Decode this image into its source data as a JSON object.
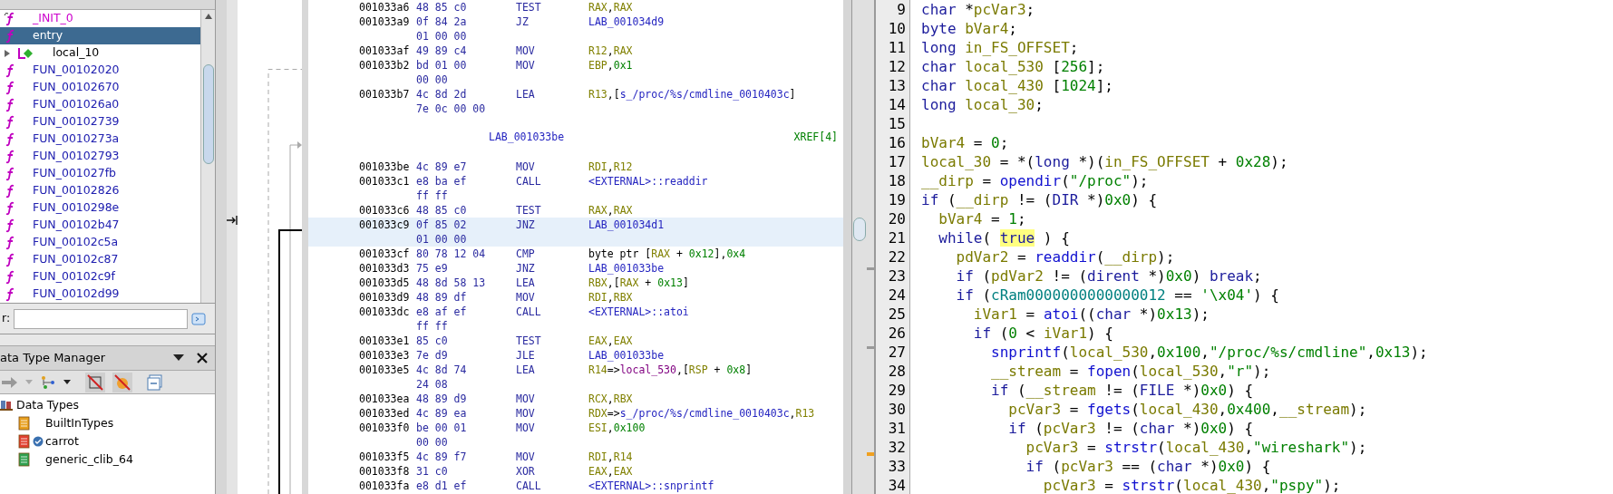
{
  "symbol_tree": {
    "items": [
      {
        "kind": "thunk",
        "label": "_INIT_0",
        "selected": false
      },
      {
        "kind": "function",
        "label": "entry",
        "selected": true
      },
      {
        "kind": "label",
        "label": "local_10",
        "selected": false,
        "expanded": false
      },
      {
        "kind": "function",
        "label": "FUN_00102020",
        "selected": false
      },
      {
        "kind": "function",
        "label": "FUN_00102670",
        "selected": false
      },
      {
        "kind": "function",
        "label": "FUN_001026a0",
        "selected": false
      },
      {
        "kind": "function",
        "label": "FUN_00102739",
        "selected": false
      },
      {
        "kind": "function",
        "label": "FUN_0010273a",
        "selected": false
      },
      {
        "kind": "function",
        "label": "FUN_00102793",
        "selected": false
      },
      {
        "kind": "function",
        "label": "FUN_001027fb",
        "selected": false
      },
      {
        "kind": "function",
        "label": "FUN_00102826",
        "selected": false
      },
      {
        "kind": "function",
        "label": "FUN_0010298e",
        "selected": false
      },
      {
        "kind": "function",
        "label": "FUN_00102b47",
        "selected": false
      },
      {
        "kind": "function",
        "label": "FUN_00102c5a",
        "selected": false
      },
      {
        "kind": "function",
        "label": "FUN_00102c87",
        "selected": false
      },
      {
        "kind": "function",
        "label": "FUN_00102c9f",
        "selected": false
      },
      {
        "kind": "function",
        "label": "FUN_00102d99",
        "selected": false
      }
    ],
    "filter_label": "r:"
  },
  "data_type_manager": {
    "title": "ata Type Manager",
    "root": "Data Types",
    "archives": [
      {
        "label": "BuiltInTypes",
        "color": "#e8a020",
        "verified": false
      },
      {
        "label": "carrot",
        "color": "#e04030",
        "verified": true
      },
      {
        "label": "generic_clib_64",
        "color": "#30a050",
        "verified": false
      }
    ]
  },
  "listing": {
    "items": [
      {
        "kind": "instruction",
        "selected": false,
        "address": "001033a6",
        "bytes": [
          "48 85 c0"
        ],
        "mnemonic": "TEST",
        "operands": [
          {
            "text": "RAX",
            "kind": "register"
          },
          {
            "text": ",",
            "kind": "plain"
          },
          {
            "text": "RAX",
            "kind": "register"
          }
        ]
      },
      {
        "kind": "instruction",
        "selected": false,
        "address": "001033a9",
        "bytes": [
          "0f 84 2a",
          "01 00 00"
        ],
        "mnemonic": "JZ",
        "operands": [
          {
            "text": "LAB_001034d9",
            "kind": "reference"
          }
        ]
      },
      {
        "kind": "instruction",
        "selected": false,
        "address": "001033af",
        "bytes": [
          "49 89 c4"
        ],
        "mnemonic": "MOV",
        "operands": [
          {
            "text": "R12",
            "kind": "register"
          },
          {
            "text": ",",
            "kind": "plain"
          },
          {
            "text": "RAX",
            "kind": "register"
          }
        ]
      },
      {
        "kind": "instruction",
        "selected": false,
        "address": "001033b2",
        "bytes": [
          "bd 01 00",
          "00 00"
        ],
        "mnemonic": "MOV",
        "operands": [
          {
            "text": "EBP",
            "kind": "register"
          },
          {
            "text": ",",
            "kind": "plain"
          },
          {
            "text": "0x1",
            "kind": "number"
          }
        ]
      },
      {
        "kind": "instruction",
        "selected": false,
        "address": "001033b7",
        "bytes": [
          "4c 8d 2d",
          "7e 0c 00 00"
        ],
        "mnemonic": "LEA",
        "operands": [
          {
            "text": "R13",
            "kind": "register"
          },
          {
            "text": ",[",
            "kind": "plain"
          },
          {
            "text": "s_/proc/%s/cmdline_0010403c",
            "kind": "reference"
          },
          {
            "text": "]",
            "kind": "plain"
          }
        ]
      },
      {
        "kind": "label",
        "selected": false,
        "label": "LAB_001033be",
        "xref": "XREF[4]"
      },
      {
        "kind": "instruction",
        "selected": false,
        "address": "001033be",
        "bytes": [
          "4c 89 e7"
        ],
        "mnemonic": "MOV",
        "operands": [
          {
            "text": "RDI",
            "kind": "register"
          },
          {
            "text": ",",
            "kind": "plain"
          },
          {
            "text": "R12",
            "kind": "register"
          }
        ]
      },
      {
        "kind": "instruction",
        "selected": false,
        "address": "001033c1",
        "bytes": [
          "e8 ba ef",
          "ff ff"
        ],
        "mnemonic": "CALL",
        "operands": [
          {
            "text": "<EXTERNAL>::readdir",
            "kind": "reference"
          }
        ]
      },
      {
        "kind": "instruction",
        "selected": false,
        "address": "001033c6",
        "bytes": [
          "48 85 c0"
        ],
        "mnemonic": "TEST",
        "operands": [
          {
            "text": "RAX",
            "kind": "register"
          },
          {
            "text": ",",
            "kind": "plain"
          },
          {
            "text": "RAX",
            "kind": "register"
          }
        ]
      },
      {
        "kind": "instruction",
        "selected": true,
        "address": "001033c9",
        "bytes": [
          "0f 85 02",
          "01 00 00"
        ],
        "mnemonic": "JNZ",
        "operands": [
          {
            "text": "LAB_001034d1",
            "kind": "reference"
          }
        ]
      },
      {
        "kind": "instruction",
        "selected": false,
        "address": "001033cf",
        "bytes": [
          "80 78 12 04"
        ],
        "mnemonic": "CMP",
        "operands": [
          {
            "text": "byte ptr [",
            "kind": "plain"
          },
          {
            "text": "RAX",
            "kind": "register"
          },
          {
            "text": " + ",
            "kind": "plain"
          },
          {
            "text": "0x12",
            "kind": "number"
          },
          {
            "text": "],",
            "kind": "plain"
          },
          {
            "text": "0x4",
            "kind": "number"
          }
        ]
      },
      {
        "kind": "instruction",
        "selected": false,
        "address": "001033d3",
        "bytes": [
          "75 e9"
        ],
        "mnemonic": "JNZ",
        "operands": [
          {
            "text": "LAB_001033be",
            "kind": "reference"
          }
        ]
      },
      {
        "kind": "instruction",
        "selected": false,
        "address": "001033d5",
        "bytes": [
          "48 8d 58 13"
        ],
        "mnemonic": "LEA",
        "operands": [
          {
            "text": "RBX",
            "kind": "register"
          },
          {
            "text": ",[",
            "kind": "plain"
          },
          {
            "text": "RAX",
            "kind": "register"
          },
          {
            "text": " + ",
            "kind": "plain"
          },
          {
            "text": "0x13",
            "kind": "number"
          },
          {
            "text": "]",
            "kind": "plain"
          }
        ]
      },
      {
        "kind": "instruction",
        "selected": false,
        "address": "001033d9",
        "bytes": [
          "48 89 df"
        ],
        "mnemonic": "MOV",
        "operands": [
          {
            "text": "RDI",
            "kind": "register"
          },
          {
            "text": ",",
            "kind": "plain"
          },
          {
            "text": "RBX",
            "kind": "register"
          }
        ]
      },
      {
        "kind": "instruction",
        "selected": false,
        "address": "001033dc",
        "bytes": [
          "e8 af ef",
          "ff ff"
        ],
        "mnemonic": "CALL",
        "operands": [
          {
            "text": "<EXTERNAL>::atoi",
            "kind": "reference"
          }
        ]
      },
      {
        "kind": "instruction",
        "selected": false,
        "address": "001033e1",
        "bytes": [
          "85 c0"
        ],
        "mnemonic": "TEST",
        "operands": [
          {
            "text": "EAX",
            "kind": "register"
          },
          {
            "text": ",",
            "kind": "plain"
          },
          {
            "text": "EAX",
            "kind": "register"
          }
        ]
      },
      {
        "kind": "instruction",
        "selected": false,
        "address": "001033e3",
        "bytes": [
          "7e d9"
        ],
        "mnemonic": "JLE",
        "operands": [
          {
            "text": "LAB_001033be",
            "kind": "reference"
          }
        ]
      },
      {
        "kind": "instruction",
        "selected": false,
        "address": "001033e5",
        "bytes": [
          "4c 8d 74",
          "24 08"
        ],
        "mnemonic": "LEA",
        "operands": [
          {
            "text": "R14",
            "kind": "register"
          },
          {
            "text": "=>",
            "kind": "plain"
          },
          {
            "text": "local_530",
            "kind": "local"
          },
          {
            "text": ",[",
            "kind": "plain"
          },
          {
            "text": "RSP",
            "kind": "register"
          },
          {
            "text": " + ",
            "kind": "plain"
          },
          {
            "text": "0x8",
            "kind": "number"
          },
          {
            "text": "]",
            "kind": "plain"
          }
        ]
      },
      {
        "kind": "instruction",
        "selected": false,
        "address": "001033ea",
        "bytes": [
          "48 89 d9"
        ],
        "mnemonic": "MOV",
        "operands": [
          {
            "text": "RCX",
            "kind": "register"
          },
          {
            "text": ",",
            "kind": "plain"
          },
          {
            "text": "RBX",
            "kind": "register"
          }
        ]
      },
      {
        "kind": "instruction",
        "selected": false,
        "address": "001033ed",
        "bytes": [
          "4c 89 ea"
        ],
        "mnemonic": "MOV",
        "operands": [
          {
            "text": "RDX",
            "kind": "register"
          },
          {
            "text": "=>",
            "kind": "plain"
          },
          {
            "text": "s_/proc/%s/cmdline_0010403c",
            "kind": "reference"
          },
          {
            "text": ",",
            "kind": "plain"
          },
          {
            "text": "R13",
            "kind": "register"
          }
        ]
      },
      {
        "kind": "instruction",
        "selected": false,
        "address": "001033f0",
        "bytes": [
          "be 00 01",
          "00 00"
        ],
        "mnemonic": "MOV",
        "operands": [
          {
            "text": "ESI",
            "kind": "register"
          },
          {
            "text": ",",
            "kind": "plain"
          },
          {
            "text": "0x100",
            "kind": "number"
          }
        ]
      },
      {
        "kind": "instruction",
        "selected": false,
        "address": "001033f5",
        "bytes": [
          "4c 89 f7"
        ],
        "mnemonic": "MOV",
        "operands": [
          {
            "text": "RDI",
            "kind": "register"
          },
          {
            "text": ",",
            "kind": "plain"
          },
          {
            "text": "R14",
            "kind": "register"
          }
        ]
      },
      {
        "kind": "instruction",
        "selected": false,
        "address": "001033f8",
        "bytes": [
          "31 c0"
        ],
        "mnemonic": "XOR",
        "operands": [
          {
            "text": "EAX",
            "kind": "register"
          },
          {
            "text": ",",
            "kind": "plain"
          },
          {
            "text": "EAX",
            "kind": "register"
          }
        ]
      },
      {
        "kind": "instruction",
        "selected": false,
        "address": "001033fa",
        "bytes": [
          "e8 d1 ef"
        ],
        "mnemonic": "CALL",
        "operands": [
          {
            "text": "<EXTERNAL>::snprintf",
            "kind": "reference"
          }
        ]
      }
    ]
  },
  "decompiler": {
    "lines": [
      {
        "number": "9",
        "tokens": [
          {
            "text": "char",
            "kind": "type"
          },
          {
            "text": " *",
            "kind": "plain"
          },
          {
            "text": "pcVar3",
            "kind": "variable"
          },
          {
            "text": ";",
            "kind": "plain"
          }
        ]
      },
      {
        "number": "10",
        "tokens": [
          {
            "text": "byte",
            "kind": "type"
          },
          {
            "text": " bVar4",
            "kind": "variable"
          },
          {
            "text": ";",
            "kind": "plain"
          }
        ]
      },
      {
        "number": "11",
        "tokens": [
          {
            "text": "long",
            "kind": "type"
          },
          {
            "text": " in_FS_OFFSET",
            "kind": "variable"
          },
          {
            "text": ";",
            "kind": "plain"
          }
        ]
      },
      {
        "number": "12",
        "tokens": [
          {
            "text": "char",
            "kind": "type"
          },
          {
            "text": " local_530",
            "kind": "variable"
          },
          {
            "text": " [",
            "kind": "plain"
          },
          {
            "text": "256",
            "kind": "number"
          },
          {
            "text": "];",
            "kind": "plain"
          }
        ]
      },
      {
        "number": "13",
        "tokens": [
          {
            "text": "char",
            "kind": "type"
          },
          {
            "text": " local_430",
            "kind": "variable"
          },
          {
            "text": " [",
            "kind": "plain"
          },
          {
            "text": "1024",
            "kind": "number"
          },
          {
            "text": "];",
            "kind": "plain"
          }
        ]
      },
      {
        "number": "14",
        "tokens": [
          {
            "text": "long",
            "kind": "type"
          },
          {
            "text": " local_30",
            "kind": "variable"
          },
          {
            "text": ";",
            "kind": "plain"
          }
        ]
      },
      {
        "number": "15"
      },
      {
        "number": "16",
        "tokens": [
          {
            "text": "bVar4",
            "kind": "variable"
          },
          {
            "text": " = ",
            "kind": "plain"
          },
          {
            "text": "0",
            "kind": "number"
          },
          {
            "text": ";",
            "kind": "plain"
          }
        ]
      },
      {
        "number": "17",
        "tokens": [
          {
            "text": "local_30",
            "kind": "variable"
          },
          {
            "text": " = *(",
            "kind": "plain"
          },
          {
            "text": "long",
            "kind": "type"
          },
          {
            "text": " *)(",
            "kind": "plain"
          },
          {
            "text": "in_FS_OFFSET",
            "kind": "variable"
          },
          {
            "text": " + ",
            "kind": "plain"
          },
          {
            "text": "0x28",
            "kind": "number"
          },
          {
            "text": ");",
            "kind": "plain"
          }
        ]
      },
      {
        "number": "18",
        "tokens": [
          {
            "text": "__dirp",
            "kind": "variable"
          },
          {
            "text": " = ",
            "kind": "plain"
          },
          {
            "text": "opendir",
            "kind": "function"
          },
          {
            "text": "(",
            "kind": "plain"
          },
          {
            "text": "\"/proc\"",
            "kind": "number"
          },
          {
            "text": ");",
            "kind": "plain"
          }
        ]
      },
      {
        "number": "19",
        "tokens": [
          {
            "text": "if",
            "kind": "keyword"
          },
          {
            "text": " (",
            "kind": "plain"
          },
          {
            "text": "__dirp",
            "kind": "variable"
          },
          {
            "text": " != (",
            "kind": "plain"
          },
          {
            "text": "DIR",
            "kind": "type"
          },
          {
            "text": " *)",
            "kind": "plain"
          },
          {
            "text": "0x0",
            "kind": "number"
          },
          {
            "text": ") {",
            "kind": "plain"
          }
        ]
      },
      {
        "number": "20",
        "tokens": [
          {
            "text": "  bVar4",
            "kind": "variable"
          },
          {
            "text": " = ",
            "kind": "plain"
          },
          {
            "text": "1",
            "kind": "number"
          },
          {
            "text": ";",
            "kind": "plain"
          }
        ]
      },
      {
        "number": "21",
        "tokens": [
          {
            "text": "  while",
            "kind": "keyword"
          },
          {
            "text": "( ",
            "kind": "plain"
          },
          {
            "text": "true",
            "kind": "highlight"
          },
          {
            "text": " ) {",
            "kind": "plain"
          }
        ]
      },
      {
        "number": "22",
        "tokens": [
          {
            "text": "    pdVar2",
            "kind": "variable"
          },
          {
            "text": " = ",
            "kind": "plain"
          },
          {
            "text": "readdir",
            "kind": "function"
          },
          {
            "text": "(",
            "kind": "plain"
          },
          {
            "text": "__dirp",
            "kind": "variable"
          },
          {
            "text": ");",
            "kind": "plain"
          }
        ]
      },
      {
        "number": "23",
        "tokens": [
          {
            "text": "    if",
            "kind": "keyword"
          },
          {
            "text": " (",
            "kind": "plain"
          },
          {
            "text": "pdVar2",
            "kind": "variable"
          },
          {
            "text": " != (",
            "kind": "plain"
          },
          {
            "text": "dirent",
            "kind": "type"
          },
          {
            "text": " *)",
            "kind": "plain"
          },
          {
            "text": "0x0",
            "kind": "number"
          },
          {
            "text": ") ",
            "kind": "plain"
          },
          {
            "text": "break",
            "kind": "keyword"
          },
          {
            "text": ";",
            "kind": "plain"
          }
        ]
      },
      {
        "number": "24",
        "tokens": [
          {
            "text": "    if",
            "kind": "keyword"
          },
          {
            "text": " (",
            "kind": "plain"
          },
          {
            "text": "cRam0000000000000012",
            "kind": "global"
          },
          {
            "text": " == ",
            "kind": "plain"
          },
          {
            "text": "'\\x04'",
            "kind": "number"
          },
          {
            "text": ") {",
            "kind": "plain"
          }
        ]
      },
      {
        "number": "25",
        "tokens": [
          {
            "text": "      iVar1",
            "kind": "variable"
          },
          {
            "text": " = ",
            "kind": "plain"
          },
          {
            "text": "atoi",
            "kind": "function"
          },
          {
            "text": "((",
            "kind": "plain"
          },
          {
            "text": "char",
            "kind": "type"
          },
          {
            "text": " *)",
            "kind": "plain"
          },
          {
            "text": "0x13",
            "kind": "number"
          },
          {
            "text": ");",
            "kind": "plain"
          }
        ]
      },
      {
        "number": "26",
        "tokens": [
          {
            "text": "      if",
            "kind": "keyword"
          },
          {
            "text": " (",
            "kind": "plain"
          },
          {
            "text": "0",
            "kind": "number"
          },
          {
            "text": " < ",
            "kind": "plain"
          },
          {
            "text": "iVar1",
            "kind": "variable"
          },
          {
            "text": ") {",
            "kind": "plain"
          }
        ]
      },
      {
        "number": "27",
        "tokens": [
          {
            "text": "        snprintf",
            "kind": "function"
          },
          {
            "text": "(",
            "kind": "plain"
          },
          {
            "text": "local_530",
            "kind": "variable"
          },
          {
            "text": ",",
            "kind": "plain"
          },
          {
            "text": "0x100",
            "kind": "number"
          },
          {
            "text": ",",
            "kind": "plain"
          },
          {
            "text": "\"/proc/%s/cmdline\"",
            "kind": "number"
          },
          {
            "text": ",",
            "kind": "plain"
          },
          {
            "text": "0x13",
            "kind": "number"
          },
          {
            "text": ");",
            "kind": "plain"
          }
        ]
      },
      {
        "number": "28",
        "tokens": [
          {
            "text": "        __stream",
            "kind": "variable"
          },
          {
            "text": " = ",
            "kind": "plain"
          },
          {
            "text": "fopen",
            "kind": "function"
          },
          {
            "text": "(",
            "kind": "plain"
          },
          {
            "text": "local_530",
            "kind": "variable"
          },
          {
            "text": ",",
            "kind": "plain"
          },
          {
            "text": "\"r\"",
            "kind": "number"
          },
          {
            "text": ");",
            "kind": "plain"
          }
        ]
      },
      {
        "number": "29",
        "tokens": [
          {
            "text": "        if",
            "kind": "keyword"
          },
          {
            "text": " (",
            "kind": "plain"
          },
          {
            "text": "__stream",
            "kind": "variable"
          },
          {
            "text": " != (",
            "kind": "plain"
          },
          {
            "text": "FILE",
            "kind": "type"
          },
          {
            "text": " *)",
            "kind": "plain"
          },
          {
            "text": "0x0",
            "kind": "number"
          },
          {
            "text": ") {",
            "kind": "plain"
          }
        ]
      },
      {
        "number": "30",
        "tokens": [
          {
            "text": "          pcVar3",
            "kind": "variable"
          },
          {
            "text": " = ",
            "kind": "plain"
          },
          {
            "text": "fgets",
            "kind": "function"
          },
          {
            "text": "(",
            "kind": "plain"
          },
          {
            "text": "local_430",
            "kind": "variable"
          },
          {
            "text": ",",
            "kind": "plain"
          },
          {
            "text": "0x400",
            "kind": "number"
          },
          {
            "text": ",",
            "kind": "plain"
          },
          {
            "text": "__stream",
            "kind": "variable"
          },
          {
            "text": ");",
            "kind": "plain"
          }
        ]
      },
      {
        "number": "31",
        "tokens": [
          {
            "text": "          if",
            "kind": "keyword"
          },
          {
            "text": " (",
            "kind": "plain"
          },
          {
            "text": "pcVar3",
            "kind": "variable"
          },
          {
            "text": " != (",
            "kind": "plain"
          },
          {
            "text": "char",
            "kind": "type"
          },
          {
            "text": " *)",
            "kind": "plain"
          },
          {
            "text": "0x0",
            "kind": "number"
          },
          {
            "text": ") {",
            "kind": "plain"
          }
        ]
      },
      {
        "number": "32",
        "tokens": [
          {
            "text": "            pcVar3",
            "kind": "variable"
          },
          {
            "text": " = ",
            "kind": "plain"
          },
          {
            "text": "strstr",
            "kind": "function"
          },
          {
            "text": "(",
            "kind": "plain"
          },
          {
            "text": "local_430",
            "kind": "variable"
          },
          {
            "text": ",",
            "kind": "plain"
          },
          {
            "text": "\"wireshark\"",
            "kind": "number"
          },
          {
            "text": ");",
            "kind": "plain"
          }
        ]
      },
      {
        "number": "33",
        "tokens": [
          {
            "text": "            if",
            "kind": "keyword"
          },
          {
            "text": " (",
            "kind": "plain"
          },
          {
            "text": "pcVar3",
            "kind": "variable"
          },
          {
            "text": " == (",
            "kind": "plain"
          },
          {
            "text": "char",
            "kind": "type"
          },
          {
            "text": " *)",
            "kind": "plain"
          },
          {
            "text": "0x0",
            "kind": "number"
          },
          {
            "text": ") {",
            "kind": "plain"
          }
        ]
      },
      {
        "number": "34",
        "tokens": [
          {
            "text": "              pcVar3",
            "kind": "variable"
          },
          {
            "text": " = ",
            "kind": "plain"
          },
          {
            "text": "strstr",
            "kind": "function"
          },
          {
            "text": "(",
            "kind": "plain"
          },
          {
            "text": "local_430",
            "kind": "variable"
          },
          {
            "text": ",",
            "kind": "plain"
          },
          {
            "text": "\"pspy\"",
            "kind": "number"
          },
          {
            "text": ");",
            "kind": "plain"
          }
        ]
      }
    ]
  }
}
